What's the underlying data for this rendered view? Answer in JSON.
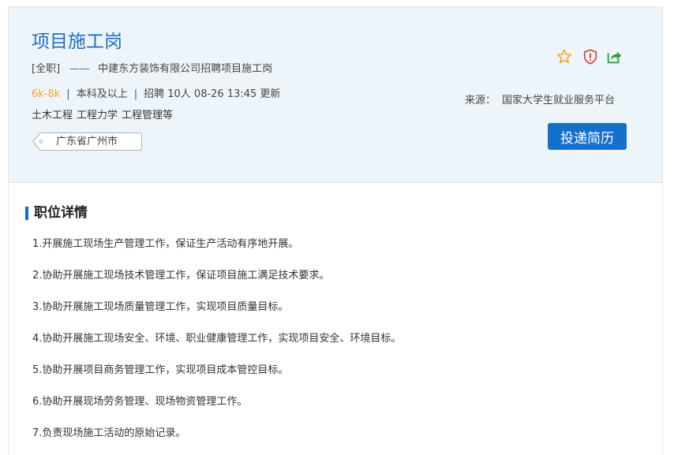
{
  "job": {
    "title": "项目施工岗",
    "type": "[全职]",
    "dash": "——",
    "company_line": "中建东方装饰有限公司招聘项目施工岗",
    "salary": "6k-8k",
    "sep": "|",
    "education": "本科及以上",
    "recruit": "招聘 10人",
    "updated": "08-26 13:45 更新",
    "majors": [
      "土木工程",
      "工程力学",
      "工程管理等"
    ],
    "location": "广东省广州市"
  },
  "source": {
    "label": "来源：",
    "value": "国家大学生就业服务平台"
  },
  "actions": {
    "apply_label": "投递简历",
    "icons": [
      "star-icon",
      "shield-alert-icon",
      "share-icon"
    ],
    "colors": {
      "star": "#f5a623",
      "shield": "#e53935",
      "share": "#2e9e3e"
    }
  },
  "detail": {
    "section_title": "职位详情",
    "duties": [
      "1.开展施工现场生产管理工作，保证生产活动有序地开展。",
      "2.协助开展施工现场技术管理工作，保证项目施工满足技术要求。",
      "3.协助开展施工现场质量管理工作，实现项目质量目标。",
      "4.协助开展施工现场安全、环境、职业健康管理工作，实现项目安全、环境目标。",
      "5.协助开展项目商务管理工作，实现项目成本管控目标。",
      "6.协助开展现场劳务管理、现场物资管理工作。",
      "7.负责现场施工活动的原始记录。"
    ]
  },
  "theme": {
    "accent": "#1570cc",
    "header_bg": "#eef5fa",
    "salary": "#f5a623"
  }
}
